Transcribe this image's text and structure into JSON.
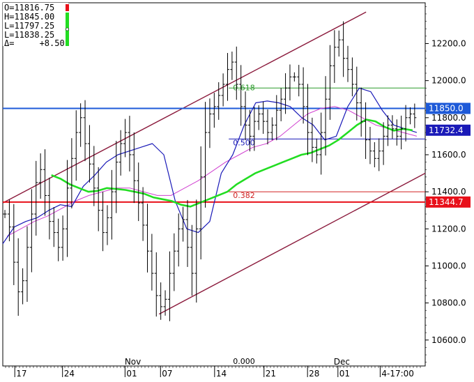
{
  "ohlc_box": {
    "open": "O=11816.75",
    "high": "H=11845.00",
    "low1": "L=11797.25",
    "low2": "L=11838.25",
    "delta": "Δ=     +8.50"
  },
  "colors": {
    "price": "#000000",
    "channel": "#8b1a3c",
    "blue_line": "#1e5ad8",
    "red_line": "#e8101a",
    "green_ma": "#22dd22",
    "navy_band": "#1a1ab8",
    "magenta_band": "#d040d0",
    "fib_green": "#2a9a2a",
    "fib_blue": "#1a1ab8",
    "fib_red": "#d02020"
  },
  "chart_data": {
    "type": "candlestick",
    "ylim": [
      10460,
      12420
    ],
    "yticks": [
      "12200.0",
      "12000.0",
      "11800.0",
      "11600.0",
      "11400.0",
      "11200.0",
      "11000.0",
      "10800.0",
      "10600.0"
    ],
    "ytick_values": [
      12200,
      12000,
      11800,
      11600,
      11400,
      11200,
      11000,
      10800,
      10600
    ],
    "x_day_labels": [
      "17",
      "24",
      "01",
      "07",
      "14",
      "21",
      "28",
      "01",
      "4-17:00"
    ],
    "x_day_positions": [
      0.035,
      0.148,
      0.296,
      0.38,
      0.508,
      0.625,
      0.728,
      0.8,
      0.9
    ],
    "x_month_labels": [
      "Nov",
      "Dec"
    ],
    "x_month_positions": [
      0.305,
      0.8
    ],
    "horizontal_lines": [
      {
        "name": "resistance",
        "value": 11850.0,
        "label": "11850.0",
        "color": "#1e5ad8"
      },
      {
        "name": "support",
        "value": 11344.7,
        "label": "11344.7",
        "color": "#e8101a"
      }
    ],
    "ma_box": {
      "value": 11732.4,
      "label": "11732.4"
    },
    "fib_levels": [
      {
        "label": "0.618",
        "value": 11960
      },
      {
        "label": "0.500",
        "value": 11685
      },
      {
        "label": "0.382",
        "value": 11400
      },
      {
        "label": "0.000",
        "value": 10460
      }
    ],
    "channel_upper": [
      {
        "x": 0.0,
        "y": 11340
      },
      {
        "x": 0.86,
        "y": 12370
      }
    ],
    "channel_lower": [
      {
        "x": 0.37,
        "y": 10740
      },
      {
        "x": 1.0,
        "y": 11500
      }
    ],
    "price_series": [
      11280,
      11210,
      11020,
      10860,
      10920,
      11100,
      11280,
      11450,
      11520,
      11380,
      11240,
      11180,
      11100,
      11200,
      11420,
      11580,
      11720,
      11800,
      11660,
      11550,
      11420,
      11300,
      11180,
      11260,
      11400,
      11560,
      11660,
      11720,
      11600,
      11460,
      11340,
      11220,
      11080,
      10960,
      10840,
      10780,
      10820,
      10960,
      11080,
      11200,
      11250,
      11100,
      10960,
      11200,
      11480,
      11720,
      11820,
      11860,
      11920,
      11980,
      12060,
      12100,
      11980,
      11860,
      11760,
      11700,
      11780,
      11820,
      11780,
      11720,
      11760,
      11840,
      11900,
      11960,
      12020,
      12020,
      11980,
      11860,
      11720,
      11640,
      11600,
      11720,
      11900,
      12080,
      12180,
      12220,
      12120,
      12060,
      11980,
      11880,
      11780,
      11680,
      11620,
      11580,
      11620,
      11700,
      11760,
      11740,
      11700,
      11740,
      11800,
      11820,
      11800
    ],
    "green_ma_series": [
      11490,
      11470,
      11440,
      11420,
      11400,
      11405,
      11420,
      11415,
      11410,
      11400,
      11390,
      11370,
      11360,
      11350,
      11330,
      11320,
      11340,
      11360,
      11380,
      11400,
      11440,
      11470,
      11500,
      11520,
      11540,
      11560,
      11580,
      11600,
      11610,
      11630,
      11650,
      11680,
      11720,
      11760,
      11790,
      11780,
      11750,
      11730,
      11740,
      11732
    ],
    "navy_series": [
      11120,
      11210,
      11240,
      11260,
      11300,
      11330,
      11320,
      11430,
      11490,
      11560,
      11600,
      11620,
      11640,
      11660,
      11600,
      11350,
      11200,
      11180,
      11240,
      11500,
      11600,
      11760,
      11880,
      11890,
      11880,
      11860,
      11800,
      11760,
      11680,
      11700,
      11860,
      11960,
      11940,
      11840,
      11760,
      11740,
      11720
    ],
    "magenta_series": [
      11160,
      11200,
      11240,
      11270,
      11310,
      11350,
      11380,
      11400,
      11420,
      11420,
      11400,
      11380,
      11380,
      11420,
      11460,
      11510,
      11560,
      11600,
      11640,
      11660,
      11700,
      11760,
      11820,
      11850,
      11860,
      11840,
      11800,
      11760,
      11740,
      11720,
      11700
    ]
  }
}
